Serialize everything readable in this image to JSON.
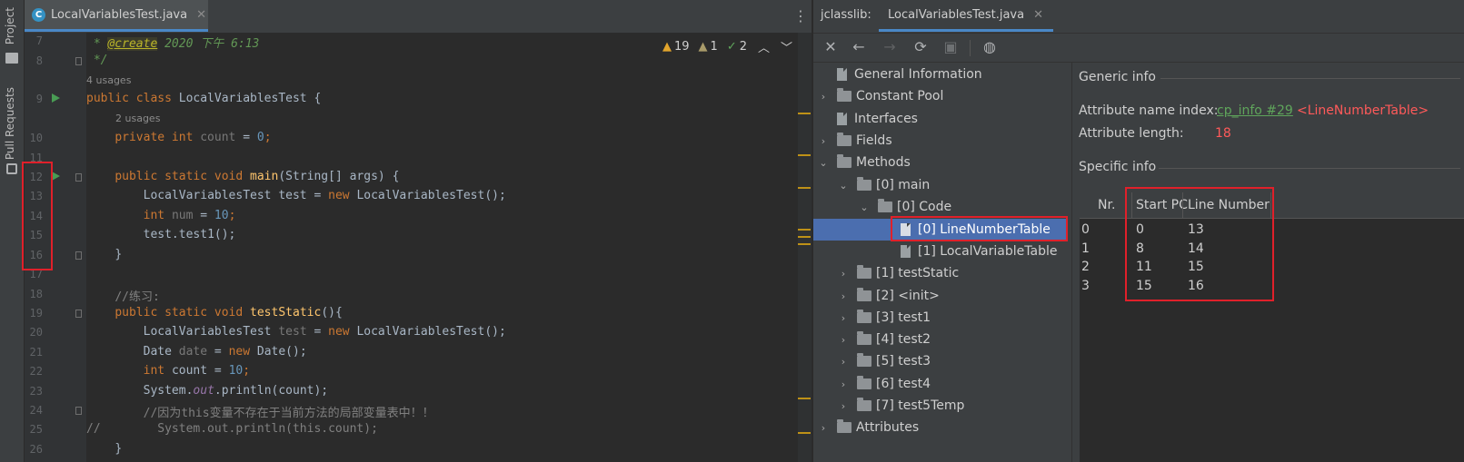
{
  "toolstrip": {
    "project_label": "Project",
    "pull_requests_label": "Pull Requests"
  },
  "editor": {
    "tab_label": "LocalVariablesTest.java",
    "inspections": {
      "warnings": "19",
      "weak_warnings": "1",
      "typos": "2"
    },
    "line_numbers": [
      "7",
      "8",
      "9",
      "10",
      "11",
      "12",
      "13",
      "14",
      "15",
      "16",
      "17",
      "18",
      "19",
      "20",
      "21",
      "22",
      "23",
      "24",
      "25",
      "26"
    ],
    "usages": {
      "class": "4 usages",
      "field": "2 usages"
    },
    "lines": {
      "l7_a": " * ",
      "l7_ann": "@create",
      "l7_b": " 2020 下午 6:13",
      "l8": " */",
      "l9_kw": "public class ",
      "l9_rest": "LocalVariablesTest {",
      "l10_kw": "private int ",
      "l10_fld": "count",
      "l10_eq": " = ",
      "l10_num": "0",
      "l10_end": ";",
      "l12_kw": "public static void ",
      "l12_fn": "main",
      "l12_rest": "(String[] args) {",
      "l13_a": "LocalVariablesTest test = ",
      "l13_kw": "new ",
      "l13_b": "LocalVariablesTest();",
      "l14_kw": "int ",
      "l14_var": "num",
      "l14_eq": " = ",
      "l14_num": "10",
      "l14_end": ";",
      "l15": "test.test1();",
      "l16": "}",
      "l18": "//练习:",
      "l19_kw": "public static void ",
      "l19_fn": "testStatic",
      "l19_rest": "(){",
      "l20_a": "LocalVariablesTest ",
      "l20_var": "test",
      "l20_eq": " = ",
      "l20_kw": "new ",
      "l20_b": "LocalVariablesTest();",
      "l21_a": "Date ",
      "l21_var": "date",
      "l21_eq": " = ",
      "l21_kw": "new ",
      "l21_b": "Date();",
      "l22_kw": "int ",
      "l22_var": "count",
      "l22_eq": " = ",
      "l22_num": "10",
      "l22_end": ";",
      "l23_a": "System.",
      "l23_out": "out",
      "l23_b": ".println(count);",
      "l24": "//因为this变量不存在于当前方法的局部变量表中！！",
      "l25_a": "//",
      "l25_b": "        System.out.println(this.count);",
      "l26": "}"
    }
  },
  "jclasslib": {
    "label": "jclasslib:",
    "tab_label": "LocalVariablesTest.java",
    "tree": {
      "general": "General Information",
      "constant_pool": "Constant Pool",
      "interfaces": "Interfaces",
      "fields": "Fields",
      "methods": "Methods",
      "main": "[0] main",
      "code": "[0] Code",
      "lnt": "[0] LineNumberTable",
      "lvt": "[1] LocalVariableTable",
      "m1": "[1] testStatic",
      "m2": "[2] <init>",
      "m3": "[3] test1",
      "m4": "[4] test2",
      "m5": "[5] test3",
      "m6": "[6] test4",
      "m7": "[7] test5Temp",
      "attributes": "Attributes"
    },
    "generic_info": {
      "heading": "Generic info",
      "name_index_label": "Attribute name index:",
      "name_index_link": "cp_info #29",
      "name_index_value": "<LineNumberTable>",
      "length_label": "Attribute length:",
      "length_value": "18"
    },
    "specific_info": {
      "heading": "Specific info",
      "columns": [
        "Nr.",
        "Start PC",
        "Line Number"
      ],
      "rows": [
        {
          "nr": "0",
          "start_pc": "0",
          "line": "13"
        },
        {
          "nr": "1",
          "start_pc": "8",
          "line": "14"
        },
        {
          "nr": "2",
          "start_pc": "11",
          "line": "15"
        },
        {
          "nr": "3",
          "start_pc": "15",
          "line": "16"
        }
      ]
    }
  },
  "colors": {
    "selection": "#4b6eaf",
    "highlight_box": "#e0202a",
    "link": "#589df6",
    "value_red": "#ff5a5a"
  }
}
